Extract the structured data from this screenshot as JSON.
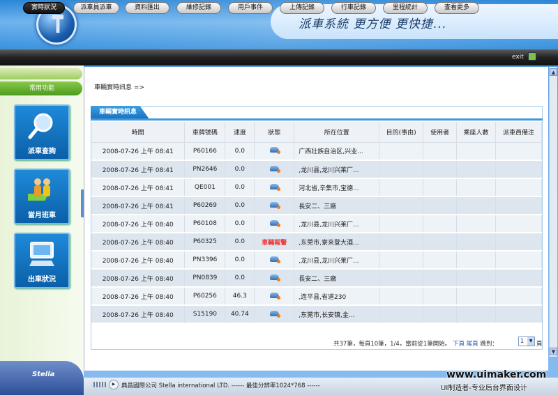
{
  "header": {
    "slogan": "派車系統 更方便 更快捷..."
  },
  "nav": {
    "items": [
      "實時狀況",
      "派車員派車",
      "資料匯出",
      "維修記錄",
      "用戶事件",
      "上傳記錄",
      "行車記錄",
      "里程統計",
      "查看更多"
    ],
    "active": "實時狀況",
    "exit_label": "exit"
  },
  "sidebar": {
    "title": "常用功能",
    "tiles": [
      {
        "label": "派車查詢",
        "icon": "search-icon"
      },
      {
        "label": "當月班車",
        "icon": "people-icon"
      },
      {
        "label": "出車狀況",
        "icon": "computer-icon"
      }
    ],
    "brand": "Stella"
  },
  "main": {
    "breadcrumb": "車輛實時訊息 =>",
    "panel_title": "車輛實時訊息",
    "table": {
      "headers": [
        "時間",
        "車牌號碼",
        "速度",
        "狀態",
        "所在位置",
        "目的(事由)",
        "使用者",
        "乘座人數",
        "派車員備注"
      ],
      "rows": [
        {
          "time": "2008-07-26 上午 08:41",
          "plate": "P60166",
          "speed": "0.0",
          "status": "",
          "location": "广西壮族自治区,兴业..."
        },
        {
          "time": "2008-07-26 上午 08:41",
          "plate": "PN2646",
          "speed": "0.0",
          "status": "",
          "location": ",龙川县,龙川兴莱厂..."
        },
        {
          "time": "2008-07-26 上午 08:41",
          "plate": "QE001",
          "speed": "0.0",
          "status": "",
          "location": "河北省,辛集市,宝德..."
        },
        {
          "time": "2008-07-26 上午 08:41",
          "plate": "P60269",
          "speed": "0.0",
          "status": "",
          "location": "長安二、三廠"
        },
        {
          "time": "2008-07-26 上午 08:40",
          "plate": "P60108",
          "speed": "0.0",
          "status": "",
          "location": ",龙川县,龙川兴莱厂..."
        },
        {
          "time": "2008-07-26 上午 08:40",
          "plate": "P60325",
          "speed": "0.0",
          "status": "車輛報警",
          "location": ",东莞市,寮来登大酒..."
        },
        {
          "time": "2008-07-26 上午 08:40",
          "plate": "PN3396",
          "speed": "0.0",
          "status": "",
          "location": ",龙川县,龙川兴莱厂..."
        },
        {
          "time": "2008-07-26 上午 08:40",
          "plate": "PN0839",
          "speed": "0.0",
          "status": "",
          "location": "長安二、三廠"
        },
        {
          "time": "2008-07-26 上午 08:40",
          "plate": "P60256",
          "speed": "46.3",
          "status": "",
          "location": ",连平县,省道230"
        },
        {
          "time": "2008-07-26 上午 08:40",
          "plate": "S15190",
          "speed": "40.74",
          "status": "",
          "location": ",东莞市,长安镇,金..."
        }
      ]
    },
    "pager": {
      "summary": "共37筆，每頁10筆，1/4，當前從1筆開始。",
      "next": "下頁",
      "last": "尾頁",
      "jump_label": "跳到：",
      "page_value": "1",
      "page_suffix": "頁"
    }
  },
  "footer": {
    "text": "典昌國際公司  Stella international LTD. ------ 最佳分辨率1024*768 ------"
  },
  "watermark": {
    "site": "www.uimaker.com",
    "caption": "UI制造者-专业后台界面设计"
  }
}
